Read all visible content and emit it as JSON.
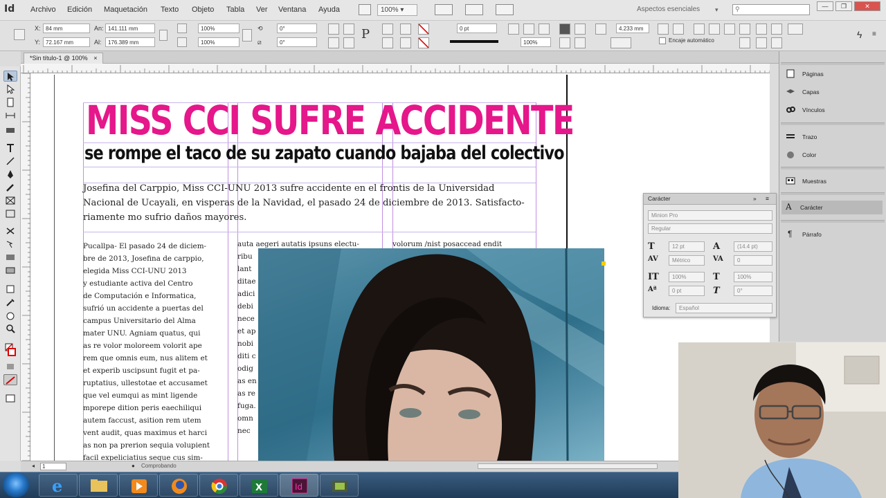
{
  "app": {
    "logo": "Id"
  },
  "menubar": {
    "items": [
      "Archivo",
      "Edición",
      "Maquetación",
      "Texto",
      "Objeto",
      "Tabla",
      "Ver",
      "Ventana",
      "Ayuda"
    ],
    "zoom": "100%",
    "workspace": "Aspectos esenciales",
    "search_placeholder": "",
    "window_buttons": [
      "—",
      "❐",
      "✕"
    ]
  },
  "control_panel": {
    "x_label": "X:",
    "x_value": "84 mm",
    "y_label": "Y:",
    "y_value": "72.167 mm",
    "w_label": "An:",
    "w_value": "141.111 mm",
    "h_label": "Al:",
    "h_value": "176.389 mm",
    "scale_x": "100%",
    "scale_y": "100%",
    "angle_value": "0°",
    "shear_value": "0°",
    "stroke_weight": "0 pt",
    "gap_value": "4.233 mm",
    "opacity": "100%",
    "autofit_label": "Encaje automático"
  },
  "document": {
    "tab_title": "*Sin título-1 @ 100%",
    "headline": "MISS CCI SUFRE ACCIDENTE",
    "subheadline": "se rompe el taco de su zapato cuando bajaba del colectivo",
    "lead": "Josefina del Carppio, Miss CCI-UNU 2013 sufre accidente en el frontis de la Universidad Nacional de Ucayali, en visperas de la Navidad, el pasado 24 de diciembre de 2013. Satisfacto-riamente mo sufrio daños mayores.",
    "col1_lines": [
      "Pucallpa- El pasado 24 de diciem-",
      "bre de 2013, Josefina de carppio,",
      "elegida Miss CCI-UNU 2013",
      "y estudiante activa del Centro",
      "de Computación e Informatica,",
      "sufrió un accidente a puertas del",
      "campus Universitario del Alma",
      "mater UNU.  Agniam quatus, qui",
      "as re volor moloreem volorit ape",
      "rem que omnis eum, nus alitem et",
      "et experib uscipsunt fugit et pa-",
      "ruptatius, ullestotae et accusamet",
      "que vel eumqui as mint ligende",
      "mporepe dition peris eaechiliqui",
      "autem faccust, asition rem utem",
      "vent audit, quas maximus et harci",
      "as non pa prerion sequia volupient",
      "facil expeliciatius seque cus sim-"
    ],
    "col2_top": "auta aegeri autatis ipsuns electu-",
    "col2_lines": [
      "ribu",
      "lant",
      "ditae",
      "adici",
      "debi",
      "nece",
      "et ap",
      "nobi",
      "diti c",
      "odig",
      "as en",
      "as re",
      "fuga.",
      "omn",
      "nec"
    ],
    "col3_top": "volorum /nist posaccead endit"
  },
  "statusbar": {
    "page": "1",
    "status": "Comprobando"
  },
  "panels": {
    "items": [
      {
        "label": "Páginas",
        "icon": "pages-icon"
      },
      {
        "label": "Capas",
        "icon": "layers-icon"
      },
      {
        "label": "Vínculos",
        "icon": "links-icon"
      },
      {
        "label": "Trazo",
        "icon": "stroke-icon"
      },
      {
        "label": "Color",
        "icon": "color-icon"
      },
      {
        "label": "Muestras",
        "icon": "swatches-icon"
      },
      {
        "label": "Carácter",
        "icon": "character-icon"
      },
      {
        "label": "Párrafo",
        "icon": "paragraph-icon"
      }
    ]
  },
  "character_panel": {
    "title": "Carácter",
    "font_family": "Minion Pro",
    "font_style": "Regular",
    "size": "12 pt",
    "leading": "(14.4 pt)",
    "kerning": "Métrico",
    "tracking": "0",
    "vscale": "100%",
    "hscale": "100%",
    "baseline": "0 pt",
    "skew": "0°",
    "language_label": "Idioma:",
    "language": "Español"
  },
  "colors": {
    "headline": "#e5178a",
    "guide": "#c48ee0"
  }
}
